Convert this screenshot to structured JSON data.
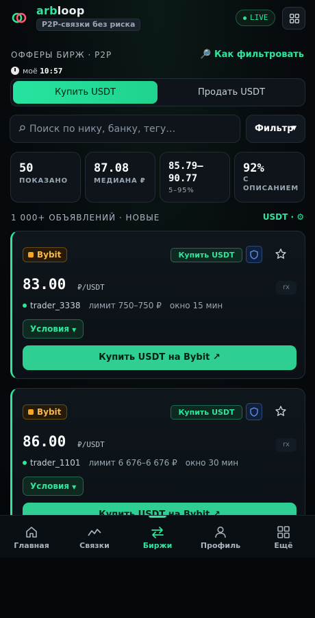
{
  "header": {
    "brand_a": "arb",
    "brand_b": "loop",
    "tagline": "P2P-связки без риска",
    "live": "LIVE"
  },
  "section": {
    "title": "ОФФЕРЫ БИРЖ · P2P",
    "filter_help": "🔎 Как фильтровать",
    "time_label": "моё",
    "time": "10:57"
  },
  "toggle": {
    "buy": "Купить USDT",
    "sell": "Продать USDT"
  },
  "search": {
    "placeholder": "Поиск по нику, банку, тегу…",
    "filter_label": "Фильтр"
  },
  "stats": [
    {
      "value": "50",
      "label": "ПОКАЗАНО"
    },
    {
      "value": "87.08",
      "label": "МЕДИАНА ₽"
    },
    {
      "value": "85.79–90.77",
      "label": "5–95%"
    },
    {
      "value": "92%",
      "label": "С ОПИСАНИЕМ"
    }
  ],
  "list": {
    "title": "1 000+ ОБЪЯВЛЕНИЙ · НОВЫЕ",
    "token": "USDT · ⚙"
  },
  "offers": [
    {
      "exchange": "Bybit",
      "side_tag": "Купить USDT",
      "price": "83.00",
      "unit": "₽/USDT",
      "rx": "rx",
      "trader": "trader_3338",
      "limit": "лимит 750–750 ₽",
      "window": "окно 15 мин",
      "conditions": "Условия",
      "cta": "Купить USDT на Bybit ↗"
    },
    {
      "exchange": "Bybit",
      "side_tag": "Купить USDT",
      "price": "86.00",
      "unit": "₽/USDT",
      "rx": "rx",
      "trader": "trader_1101",
      "limit": "лимит 6 676–6 676 ₽",
      "window": "окно 30 мин",
      "conditions": "Условия",
      "cta": "Купить USDT на Bybit ↗"
    }
  ],
  "nav": [
    {
      "label": "Главная",
      "icon": "home-icon"
    },
    {
      "label": "Связки",
      "icon": "chart-line-icon"
    },
    {
      "label": "Биржи",
      "icon": "exchange-arrows-icon",
      "active": true
    },
    {
      "label": "Профиль",
      "icon": "user-icon"
    },
    {
      "label": "Ещё",
      "icon": "grid-icon"
    }
  ],
  "colors": {
    "accent": "#2ee59d",
    "exchange_badge": "#f7b84a",
    "background": "#05080b"
  }
}
